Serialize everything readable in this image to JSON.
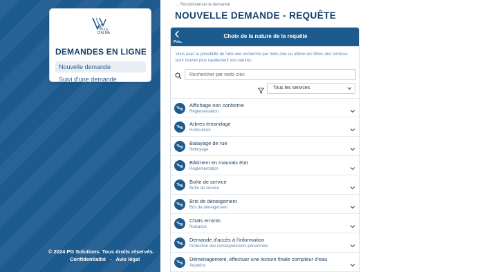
{
  "sidebar": {
    "logo_text": "VILLE D'ALMA",
    "title": "DEMANDES EN LIGNE",
    "items": [
      {
        "label": "Nouvelle demande",
        "active": true
      },
      {
        "label": "Suivi d'une demande",
        "active": false
      }
    ],
    "footer": {
      "copyright": "© 2024 PG Solutions. Tous droits réservés.",
      "privacy": "Confidentialité",
      "separator": "-",
      "legal": "Avis légal"
    }
  },
  "main": {
    "restart_link": "← Recommencer la demande",
    "title": "NOUVELLE DEMANDE - REQUÊTE",
    "card": {
      "back_label": "Préc.",
      "title": "Choix de la nature de la requête",
      "intro": "Vous avez la possibilité de faire une recherche par mots clés ou utiliser les filtres des services pour trouver plus rapidement vos natures.",
      "search_placeholder": "Rechercher par mots clés",
      "service_filter": "Tous les services",
      "items": [
        {
          "title": "Affichage non conforme",
          "service": "Réglementation"
        },
        {
          "title": "Arbres émondage",
          "service": "Horticulture"
        },
        {
          "title": "Balayage de rue",
          "service": "Nettoyage"
        },
        {
          "title": "Bâtiment en mauvais état",
          "service": "Réglementation"
        },
        {
          "title": "Boîte de service",
          "service": "Boîte de service"
        },
        {
          "title": "Bris de déneigement",
          "service": "Bris de déneigement"
        },
        {
          "title": "Chats errants",
          "service": "Nuisance"
        },
        {
          "title": "Demande d'accès à l'information",
          "service": "Protection des renseignements personnels"
        },
        {
          "title": "Déménagement, effectuer une lecture finale compteur d'eau",
          "service": "Aqueduc"
        }
      ]
    }
  },
  "colors": {
    "brand_blue": "#1d5a8e",
    "heading": "#163f6b"
  },
  "icons": {
    "back": "chevron-left-icon",
    "search": "search-icon",
    "filter": "filter-icon",
    "item": "request-icon",
    "expand": "chevron-down-icon"
  }
}
